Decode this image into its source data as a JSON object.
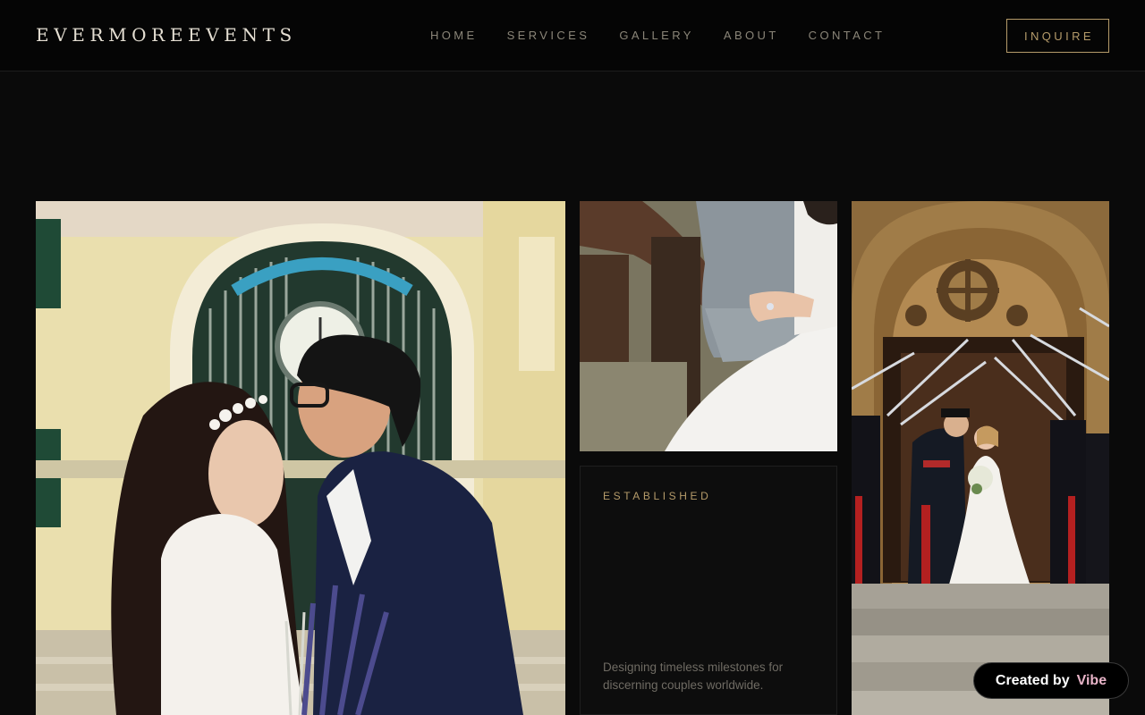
{
  "header": {
    "logo": "EVERMOREEVENTS",
    "nav": [
      {
        "label": "HOME"
      },
      {
        "label": "SERVICES"
      },
      {
        "label": "GALLERY"
      },
      {
        "label": "ABOUT"
      },
      {
        "label": "CONTACT"
      }
    ],
    "cta_label": "INQUIRE"
  },
  "card": {
    "label": "ESTABLISHED",
    "text": "Designing timeless milestones for discerning couples worldwide."
  },
  "badge": {
    "prefix": "Created by",
    "brand": "Vibe"
  },
  "colors": {
    "background": "#0a0a0a",
    "accent_gold": "#b59b6a",
    "nav_text": "#8a8578"
  }
}
